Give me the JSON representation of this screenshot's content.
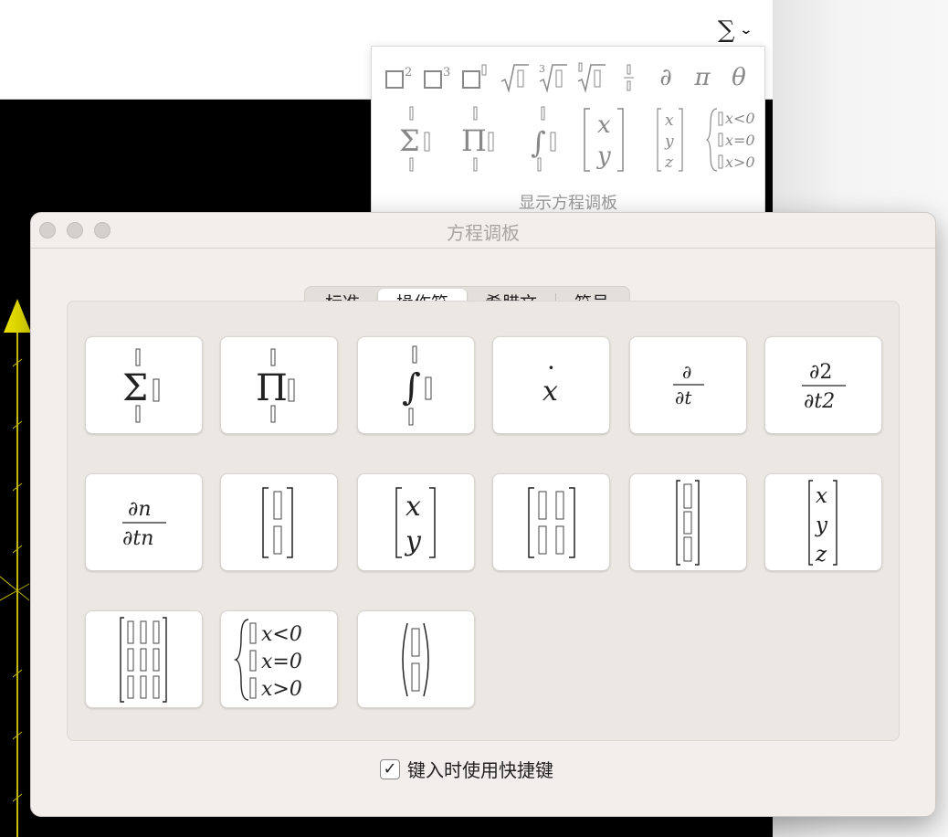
{
  "toolbar": {
    "equation_button_symbol": "∑",
    "chevron": "⌄"
  },
  "popup": {
    "row1": [
      "□²",
      "□³",
      "□▯",
      "√▯",
      "∛▯",
      "▯√▯",
      "▯/▯",
      "∂",
      "π",
      "θ"
    ],
    "footer": "显示方程调板"
  },
  "window": {
    "title": "方程调板",
    "tabs": [
      "标准",
      "操作符",
      "希腊文",
      "符号"
    ],
    "active_tab": "操作符",
    "checkbox_checked": true,
    "checkbox_mark": "✓",
    "checkbox_label": "键入时使用快捷键"
  },
  "tile_texts": {
    "sum": "Σ",
    "product": "Π",
    "integral": "∫",
    "dot_x": "x",
    "dot": "·",
    "partial": "∂",
    "dt": "∂t",
    "partial2": "∂2",
    "dt2": "∂t2",
    "partialn": "∂n",
    "dtn": "∂tn",
    "x": "x",
    "y": "y",
    "z": "z",
    "xlt0": "x<0",
    "xeq0": "x=0",
    "xgt0": "x>0"
  },
  "colors": {
    "window_bg": "#f2eeeb",
    "tile_bg": "#ffffff",
    "arrow_yellow": "#e8e000"
  }
}
